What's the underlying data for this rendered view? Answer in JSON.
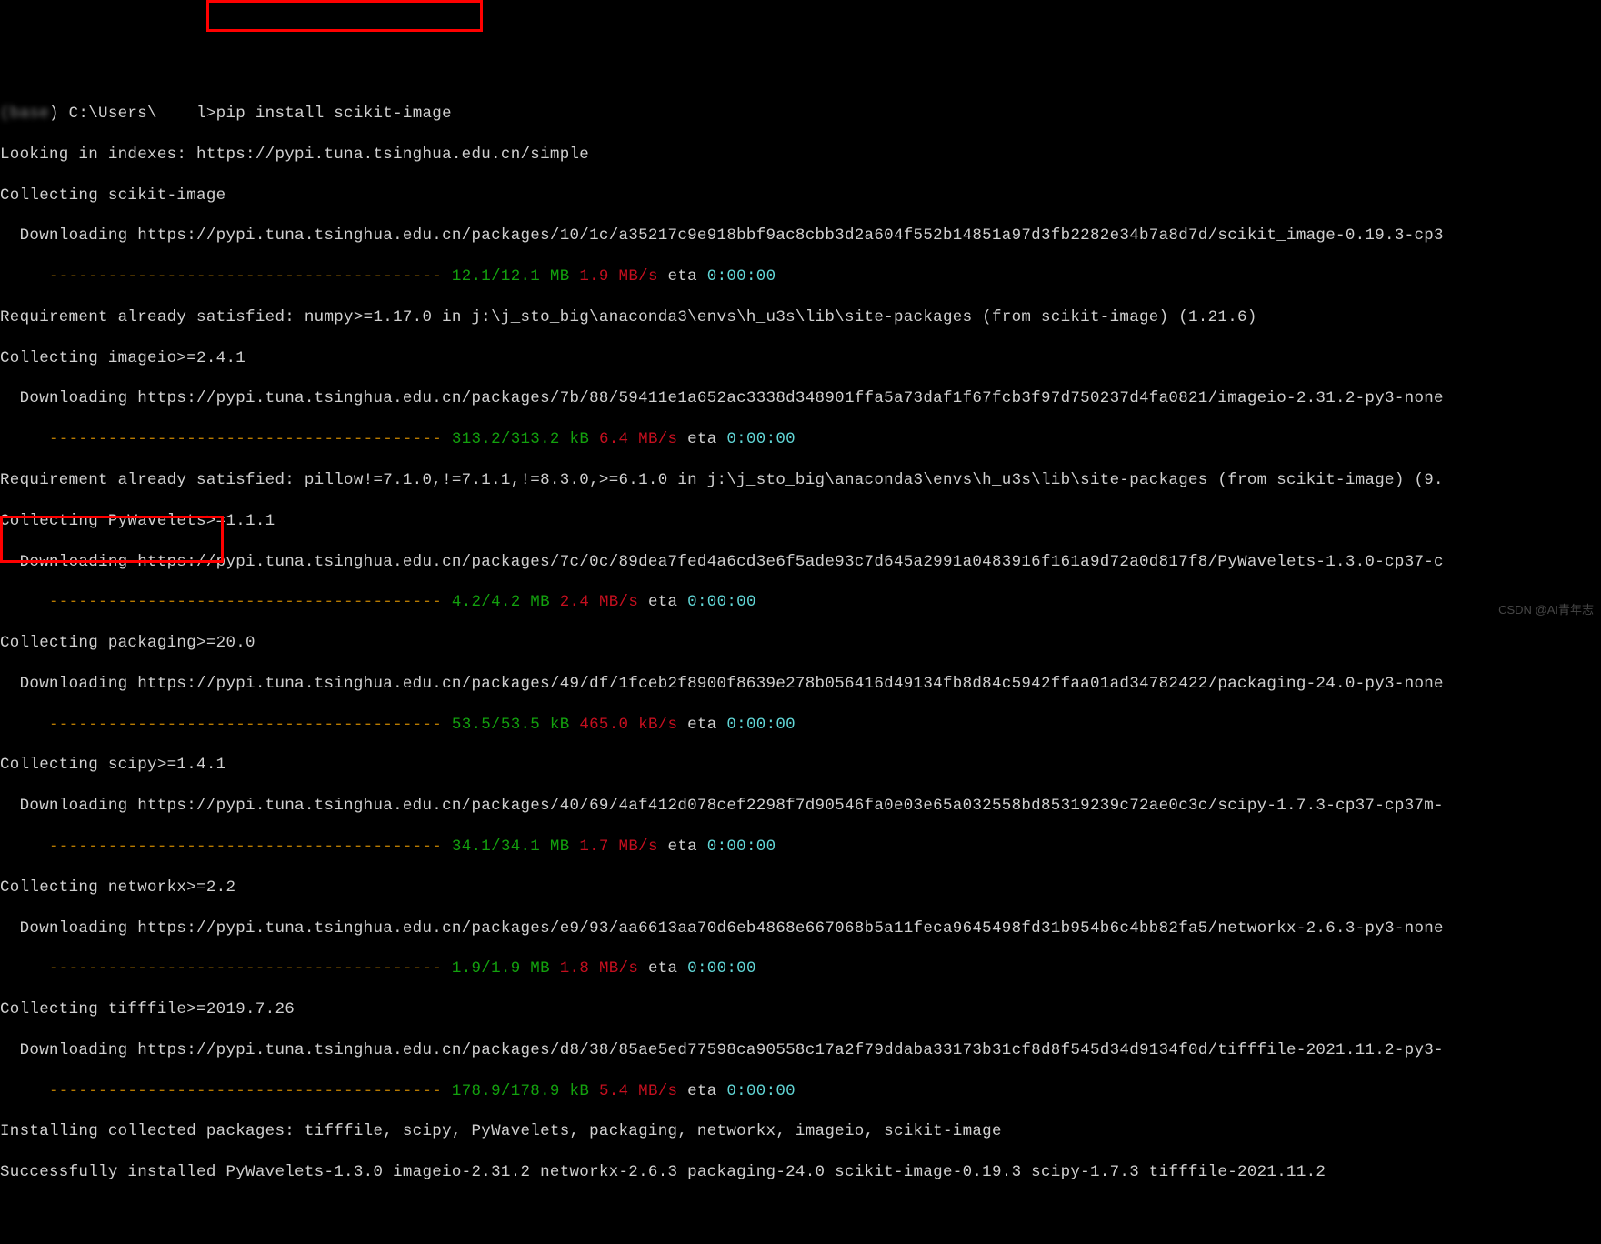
{
  "prompt": {
    "prefix_blur": "(base",
    "path": ") C:\\Users\\",
    "user_blur": "    ",
    "end": "l>",
    "command": "pip install scikit-image"
  },
  "lines": {
    "l01": "Looking in indexes: https://pypi.tuna.tsinghua.edu.cn/simple",
    "l02": "Collecting scikit-image",
    "l03": "  Downloading https://pypi.tuna.tsinghua.edu.cn/packages/10/1c/a35217c9e918bbf9ac8cbb3d2a604f552b14851a97d3fb2282e34b7a8d7d/scikit_image-0.19.3-cp3",
    "l05": "Requirement already satisfied: numpy>=1.17.0 in j:\\j_sto_big\\anaconda3\\envs\\h_u3s\\lib\\site-packages (from scikit-image) (1.21.6)",
    "l06": "Collecting imageio>=2.4.1",
    "l07": "  Downloading https://pypi.tuna.tsinghua.edu.cn/packages/7b/88/59411e1a652ac3338d348901ffa5a73daf1f67fcb3f97d750237d4fa0821/imageio-2.31.2-py3-none",
    "l09": "Requirement already satisfied: pillow!=7.1.0,!=7.1.1,!=8.3.0,>=6.1.0 in j:\\j_sto_big\\anaconda3\\envs\\h_u3s\\lib\\site-packages (from scikit-image) (9.",
    "l10": "Collecting PyWavelets>=1.1.1",
    "l11": "  Downloading https://pypi.tuna.tsinghua.edu.cn/packages/7c/0c/89dea7fed4a6cd3e6f5ade93c7d645a2991a0483916f161a9d72a0d817f8/PyWavelets-1.3.0-cp37-c",
    "l13": "Collecting packaging>=20.0",
    "l14": "  Downloading https://pypi.tuna.tsinghua.edu.cn/packages/49/df/1fceb2f8900f8639e278b056416d49134fb8d84c5942ffaa01ad34782422/packaging-24.0-py3-none",
    "l16": "Collecting scipy>=1.4.1",
    "l17": "  Downloading https://pypi.tuna.tsinghua.edu.cn/packages/40/69/4af412d078cef2298f7d90546fa0e03e65a032558bd85319239c72ae0c3c/scipy-1.7.3-cp37-cp37m-",
    "l19": "Collecting networkx>=2.2",
    "l20": "  Downloading https://pypi.tuna.tsinghua.edu.cn/packages/e9/93/aa6613aa70d6eb4868e667068b5a11feca9645498fd31b954b6c4bb82fa5/networkx-2.6.3-py3-none",
    "l22": "Collecting tifffile>=2019.7.26",
    "l23": "  Downloading https://pypi.tuna.tsinghua.edu.cn/packages/d8/38/85ae5ed77598ca90558c17a2f79ddaba33173b31cf8d8f545d34d9134f0d/tifffile-2021.11.2-py3-",
    "l25": "Installing collected packages: tifffile, scipy, PyWavelets, packaging, networkx, imageio, scikit-image",
    "l26": "Successfully installed PyWavelets-1.3.0 imageio-2.31.2 networkx-2.6.3 packaging-24.0 scikit-image-0.19.3 scipy-1.7.3 tifffile-2021.11.2"
  },
  "progress": {
    "dashes": "     ---------------------------------------- ",
    "p1": {
      "size": "12.1/12.1 MB",
      "speed": "1.9 MB/s",
      "eta_label": " eta ",
      "eta": "0:00:00"
    },
    "p2": {
      "size": "313.2/313.2 kB",
      "speed": "6.4 MB/s",
      "eta_label": " eta ",
      "eta": "0:00:00"
    },
    "p3": {
      "size": "4.2/4.2 MB",
      "speed": "2.4 MB/s",
      "eta_label": " eta ",
      "eta": "0:00:00"
    },
    "p4": {
      "size": "53.5/53.5 kB",
      "speed": "465.0 kB/s",
      "eta_label": " eta ",
      "eta": "0:00:00"
    },
    "p5": {
      "size": "34.1/34.1 MB",
      "speed": "1.7 MB/s",
      "eta_label": " eta ",
      "eta": "0:00:00"
    },
    "p6": {
      "size": "1.9/1.9 MB",
      "speed": "1.8 MB/s",
      "eta_label": " eta ",
      "eta": "0:00:00"
    },
    "p7": {
      "size": "178.9/178.9 kB",
      "speed": "5.4 MB/s",
      "eta_label": " eta ",
      "eta": "0:00:00"
    }
  },
  "watermark": "CSDN @AI青年志"
}
